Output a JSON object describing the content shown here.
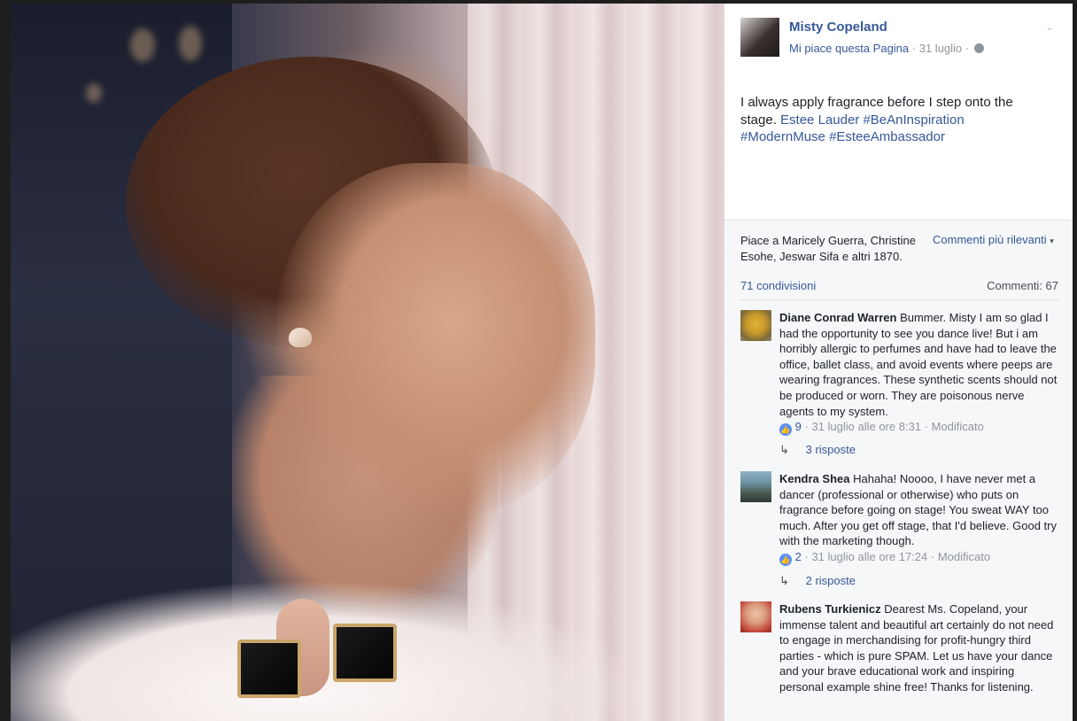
{
  "post": {
    "author": "Misty Copeland",
    "like_page": "Mi piace questa Pagina",
    "date": "31 luglio",
    "text_plain": "I always apply fragrance before I step onto the stage.",
    "links": [
      "Estee Lauder",
      "#BeAnInspiration",
      "#ModernMuse",
      "#EsteeAmbassador"
    ]
  },
  "stats": {
    "likes_text": "Piace a Maricely Guerra, Christine Esohe, Jeswar Sifa e altri 1870.",
    "sort_label": "Commenti più rilevanti",
    "shares": "71 condivisioni",
    "comments": "Commenti: 67"
  },
  "comments": [
    {
      "name": "Diane Conrad Warren",
      "text": "Bummer. Misty I am so glad I had the opportunity to see you dance live! But i am horribly allergic to perfumes and have had to leave the office, ballet class, and avoid events where peeps are wearing fragrances. These synthetic scents should not be produced or worn. They are poisonous nerve agents to my system.",
      "likes": "9",
      "time": "31 luglio alle ore 8:31",
      "edited": "Modificato",
      "replies": "3 risposte"
    },
    {
      "name": "Kendra Shea",
      "text": "Hahaha! Noooo, I have never met a dancer (professional or otherwise) who puts on fragrance before going on stage! You sweat WAY too much. After you get off stage, that I'd believe. Good try with the marketing though.",
      "likes": "2",
      "time": "31 luglio alle ore 17:24",
      "edited": "Modificato",
      "replies": "2 risposte"
    },
    {
      "name": "Rubens Turkienicz",
      "text": "Dearest Ms. Copeland, your immense talent and beautiful art certainly do not need to engage in merchandising for profit-hungry third parties - which is pure SPAM. Let us have your dance and your brave educational work and inspiring personal example shine free! Thanks for listening."
    }
  ],
  "icons": {
    "menu": "chevron-down-icon",
    "privacy": "globe-icon",
    "like": "thumbs-up-icon",
    "reply": "reply-arrow-icon"
  },
  "colors": {
    "link": "#365899",
    "meta": "#90949c",
    "like_badge": "#5890ff"
  }
}
